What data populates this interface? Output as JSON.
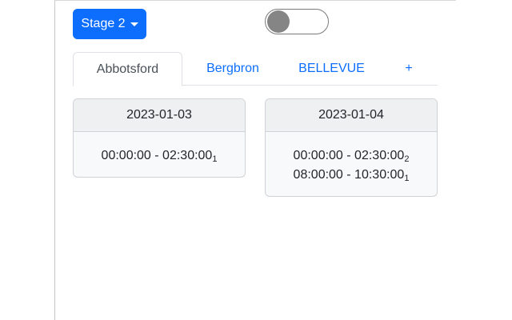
{
  "stage_button": {
    "label": "Stage 2"
  },
  "toggle": {
    "on": false
  },
  "tabs": [
    {
      "label": "Abbotsford",
      "active": true
    },
    {
      "label": "Bergbron",
      "active": false
    },
    {
      "label": "BELLEVUE",
      "active": false
    },
    {
      "label": "+",
      "active": false
    }
  ],
  "schedule": [
    {
      "date": "2023-01-03",
      "slots": [
        {
          "time": "00:00:00 - 02:30:00",
          "stage": "1"
        }
      ]
    },
    {
      "date": "2023-01-04",
      "slots": [
        {
          "time": "00:00:00 - 02:30:00",
          "stage": "2"
        },
        {
          "time": "08:00:00 - 10:30:00",
          "stage": "1"
        }
      ]
    }
  ],
  "colors": {
    "primary": "#0d6efd",
    "tab_link": "#0d6efd",
    "toggle_knob": "#858585",
    "card_header_bg": "#eff0f1",
    "card_body_bg": "#f8f9fa"
  }
}
